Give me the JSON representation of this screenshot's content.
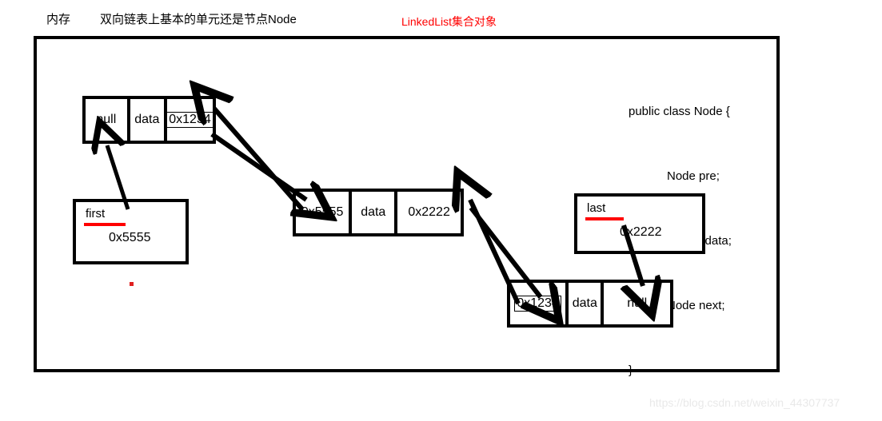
{
  "header": {
    "memory_label": "内存",
    "subtitle": "双向链表上基本的单元还是节点Node",
    "collection_label": "LinkedList集合对象"
  },
  "code": {
    "lines": [
      "public class Node {",
      "Node pre;",
      "Object data;",
      "Node next;",
      "}"
    ]
  },
  "nodes": [
    {
      "id": "node1",
      "cells": [
        {
          "text": "null",
          "boxed": false
        },
        {
          "text": "data",
          "boxed": false
        },
        {
          "text": "0x1234",
          "boxed": true
        }
      ]
    },
    {
      "id": "node2",
      "cells": [
        {
          "text": "0x5555",
          "boxed": false
        },
        {
          "text": "data",
          "boxed": false
        },
        {
          "text": "0x2222",
          "boxed": false
        }
      ]
    },
    {
      "id": "node3",
      "cells": [
        {
          "text": "0x1234",
          "boxed": true
        },
        {
          "text": "data",
          "boxed": false
        },
        {
          "text": "null",
          "boxed": false
        }
      ]
    }
  ],
  "refs": {
    "first": {
      "name": "first",
      "value": "0x5555"
    },
    "last": {
      "name": "last",
      "value": "0x2222"
    }
  },
  "watermark": "https://blog.csdn.net/weixin_44307737",
  "colors": {
    "stroke": "#000000",
    "accent_red": "#ff0000",
    "watermark": "#e9e9e9"
  }
}
